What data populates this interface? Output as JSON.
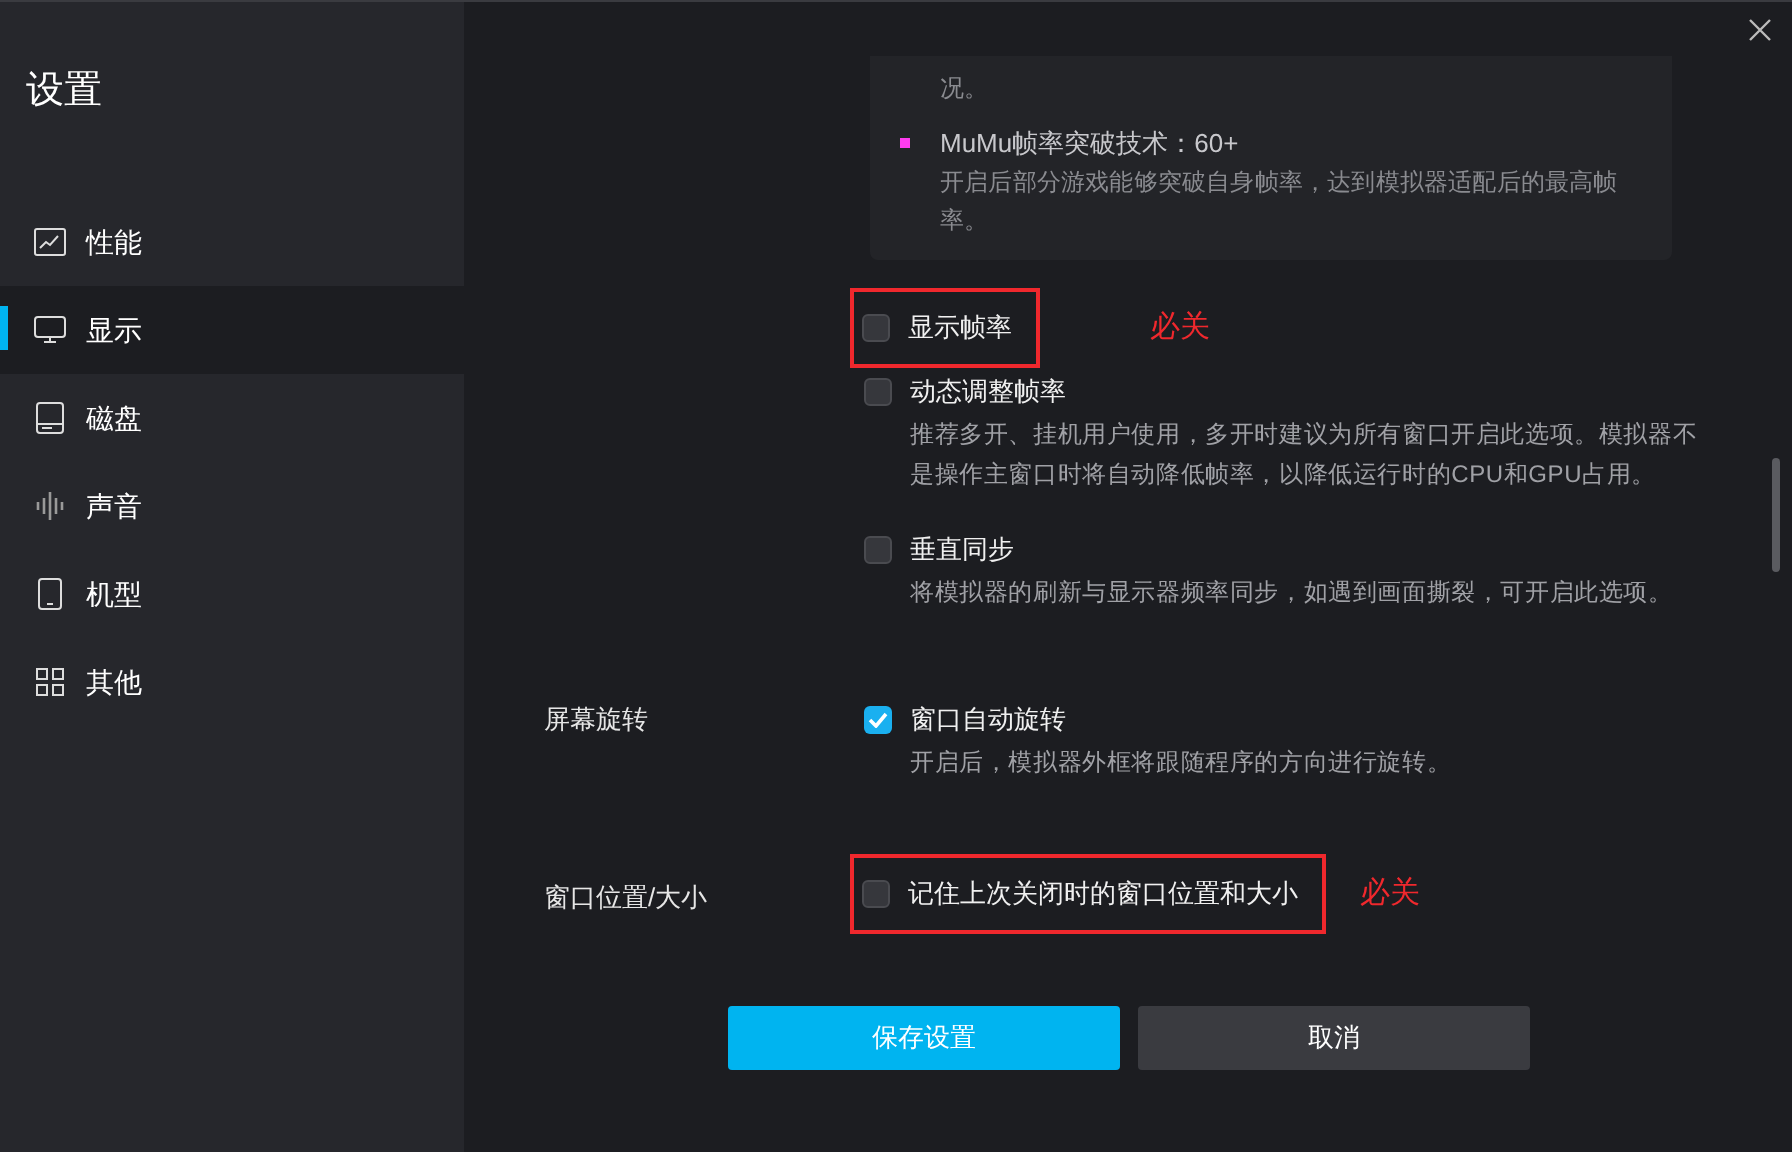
{
  "window": {
    "title": "设置"
  },
  "sidebar": {
    "items": [
      {
        "label": "性能",
        "selected": false
      },
      {
        "label": "显示",
        "selected": true
      },
      {
        "label": "磁盘",
        "selected": false
      },
      {
        "label": "声音",
        "selected": false
      },
      {
        "label": "机型",
        "selected": false
      },
      {
        "label": "其他",
        "selected": false
      }
    ]
  },
  "info_box": {
    "continued_text": "况。",
    "bullet": {
      "title": "MuMu帧率突破技术：60+",
      "description": "开启后部分游戏能够突破自身帧率，达到模拟器适配后的最高帧率。",
      "color": "#ff3cf0"
    }
  },
  "sections": [
    {
      "options": [
        {
          "label": "显示帧率",
          "checked": false,
          "highlighted": true,
          "note": "必关"
        },
        {
          "label": "动态调整帧率",
          "checked": false,
          "highlighted": false,
          "description": "推荐多开、挂机用户使用，多开时建议为所有窗口开启此选项。模拟器不是操作主窗口时将自动降低帧率，以降低运行时的CPU和GPU占用。"
        },
        {
          "label": "垂直同步",
          "checked": false,
          "highlighted": false,
          "description": "将模拟器的刷新与显示器频率同步，如遇到画面撕裂，可开启此选项。"
        }
      ]
    },
    {
      "label": "屏幕旋转",
      "options": [
        {
          "label": "窗口自动旋转",
          "checked": true,
          "highlighted": false,
          "description": "开启后，模拟器外框将跟随程序的方向进行旋转。"
        }
      ]
    },
    {
      "label": "窗口位置/大小",
      "options": [
        {
          "label": "记住上次关闭时的窗口位置和大小",
          "checked": false,
          "highlighted": true,
          "note": "必关"
        }
      ]
    }
  ],
  "buttons": [
    {
      "label": "保存设置",
      "kind": "primary"
    },
    {
      "label": "取消",
      "kind": "secondary"
    }
  ]
}
